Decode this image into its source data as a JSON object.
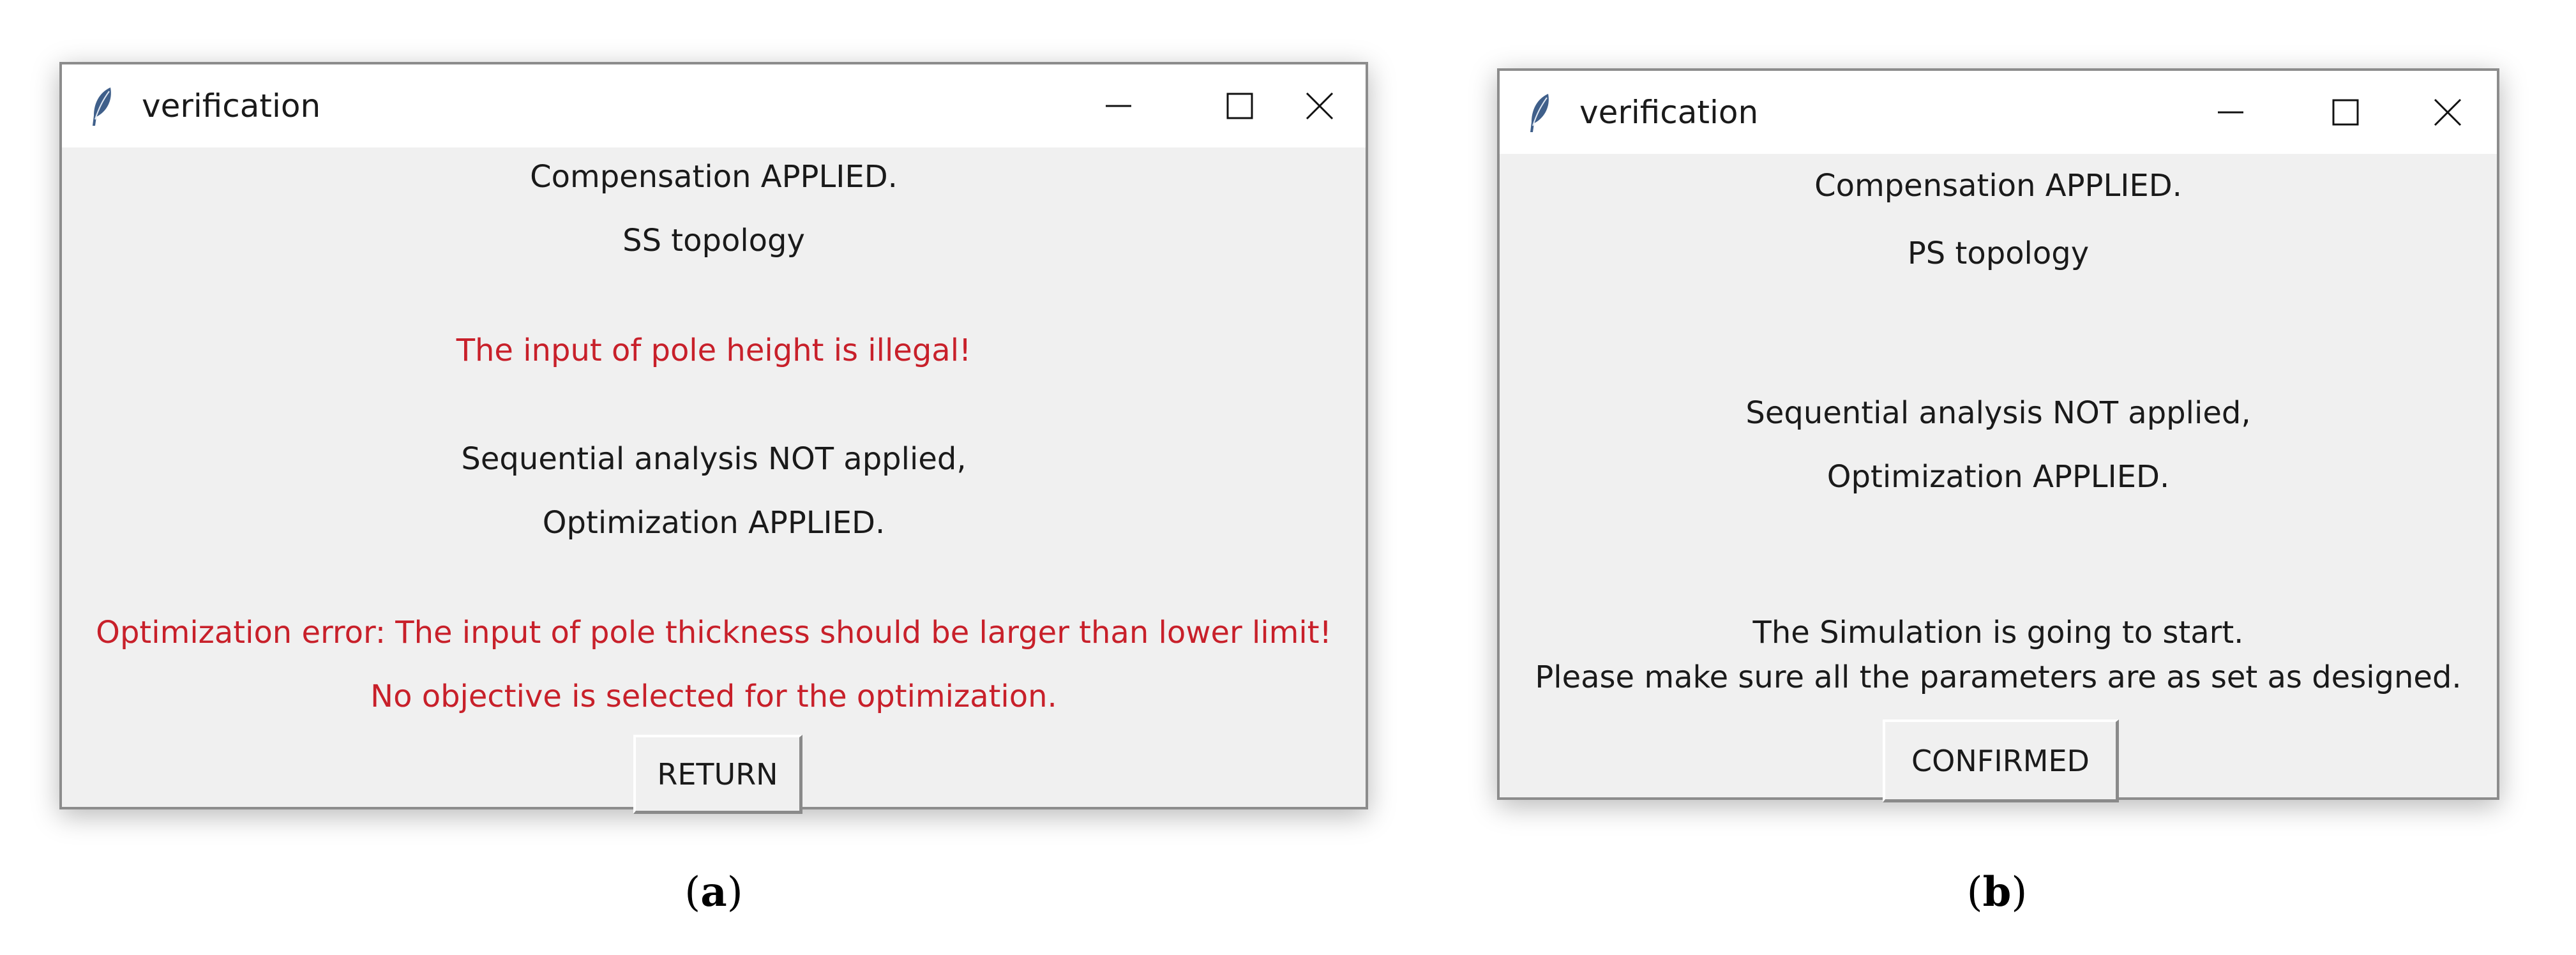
{
  "window_a": {
    "title": "verification",
    "lines": [
      "Compensation APPLIED.",
      "SS topology",
      "The input of pole height is illegal!",
      "Sequential analysis NOT applied,",
      "Optimization APPLIED.",
      "Optimization error: The input of pole thickness should be larger than lower limit!",
      "No objective is selected for the optimization."
    ],
    "button_label": "RETURN"
  },
  "window_b": {
    "title": "verification",
    "lines": [
      "Compensation APPLIED.",
      "PS topology",
      "Sequential analysis NOT applied,",
      "Optimization APPLIED.",
      "The Simulation is going to start.",
      "Please make sure all the parameters are as set as designed."
    ],
    "button_label": "CONFIRMED"
  },
  "captions": {
    "a": {
      "open": "(",
      "letter": "a",
      "close": ")"
    },
    "b": {
      "open": "(",
      "letter": "b",
      "close": ")"
    }
  },
  "colors": {
    "error_text": "#c8202a",
    "window_bg": "#f0f0f0",
    "titlebar_bg": "#ffffff"
  },
  "icons": {
    "app": "feather-icon",
    "minimize": "minimize-icon",
    "maximize": "maximize-icon",
    "close": "close-icon"
  }
}
